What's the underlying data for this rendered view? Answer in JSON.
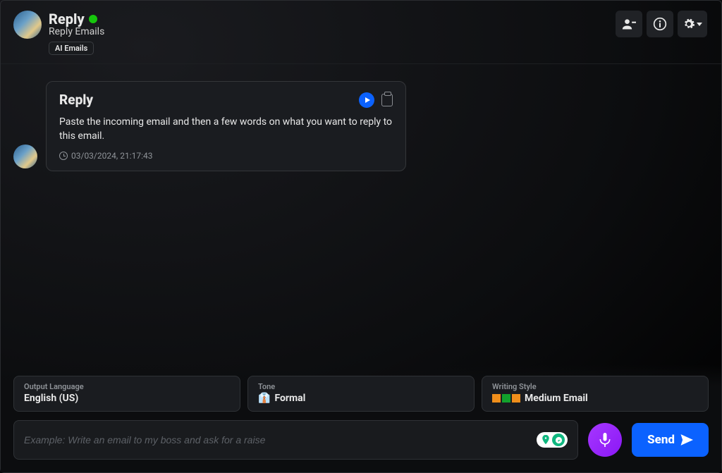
{
  "header": {
    "title": "Reply",
    "subtitle": "Reply Emails",
    "badge": "AI Emails",
    "status_color": "#16c60c"
  },
  "message": {
    "title": "Reply",
    "body": "Paste the incoming email and then a few words on what you want to reply to this email.",
    "timestamp": "03/03/2024, 21:17:43"
  },
  "controls": {
    "output_language": {
      "label": "Output Language",
      "value": "English (US)"
    },
    "tone": {
      "label": "Tone",
      "value": "Formal",
      "emoji": "👔"
    },
    "writing_style": {
      "label": "Writing Style",
      "value": "Medium Email"
    }
  },
  "composer": {
    "placeholder": "Example: Write an email to my boss and ask for a raise",
    "send_label": "Send"
  }
}
